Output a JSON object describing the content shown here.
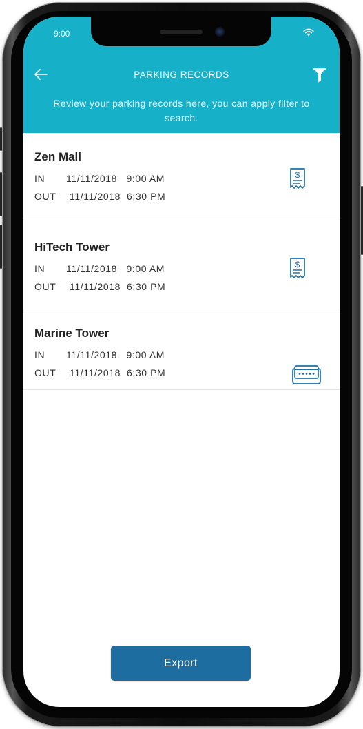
{
  "status_bar": {
    "time": "9:00",
    "wifi_icon": "wifi-icon"
  },
  "header": {
    "title": "PARKING RECORDS",
    "subtitle": "Review your parking records here, you can apply filter to search.",
    "back_icon": "arrow-left-icon",
    "filter_icon": "funnel-filter-icon",
    "background_color": "#16b1c9"
  },
  "records": [
    {
      "name": "Zen Mall",
      "in_label": "IN",
      "in_value": "11/11/2018   9:00 AM",
      "out_label": "OUT",
      "out_value": "11/11/2018  6:30 PM",
      "icon": "receipt-icon"
    },
    {
      "name": "HiTech Tower",
      "in_label": "IN",
      "in_value": "11/11/2018   9:00 AM",
      "out_label": "OUT",
      "out_value": "11/11/2018  6:30 PM",
      "icon": "receipt-icon"
    },
    {
      "name": "Marine Tower",
      "in_label": "IN",
      "in_value": "11/11/2018   9:00 AM",
      "out_label": "OUT",
      "out_value": "11/11/2018  6:30 PM",
      "icon": "card-icon"
    }
  ],
  "export": {
    "label": "Export",
    "color": "#1d6da0"
  },
  "accent_color": "#16b1c9"
}
